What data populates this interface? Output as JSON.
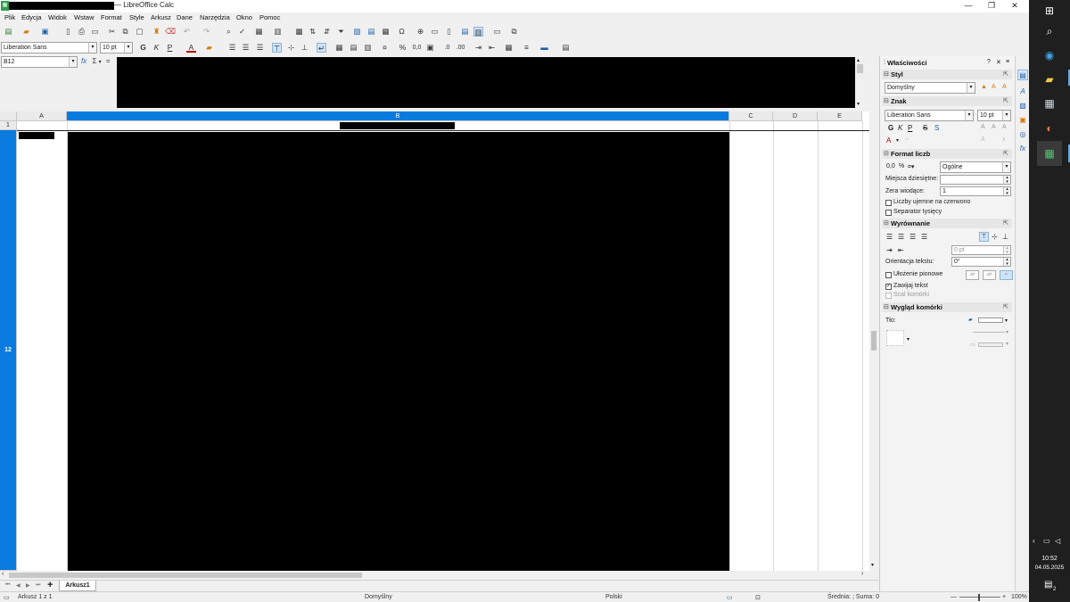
{
  "window": {
    "title": "— LibreOffice Calc",
    "controls": {
      "minimize": "—",
      "restore": "❐",
      "close": "✕"
    }
  },
  "menu": [
    "Plik",
    "Edycja",
    "Widok",
    "Wstaw",
    "Format",
    "Style",
    "Arkusz",
    "Dane",
    "Narzędzia",
    "Okno",
    "Pomoc"
  ],
  "toolbar": {
    "font_name": "Liberation Sans",
    "font_size": "10 pt",
    "bold": "G",
    "italic": "K",
    "underline": "P",
    "font_color_glyph": "A",
    "percent": "%",
    "number": "0,0"
  },
  "formula_bar": {
    "name_box": "B12",
    "fx": "fx",
    "sigma": "Σ",
    "equals": "="
  },
  "grid": {
    "columns": [
      "A",
      "B",
      "C",
      "D",
      "E"
    ],
    "active_column": "B",
    "rows": [
      "1",
      "12"
    ],
    "active_row": "12"
  },
  "sheets": {
    "active": "Arkusz1",
    "add": "+"
  },
  "status": {
    "sheet_info": "Arkusz 1 z 1",
    "page_style": "Domyślny",
    "language": "Polski",
    "summary": "Średnia: ; Suma: 0",
    "zoom": "100%"
  },
  "sidebar": {
    "title": "Właściwości",
    "help": "?",
    "close": "✕",
    "menu": "≡",
    "sections": {
      "style": {
        "title": "Styl",
        "value": "Domyślny"
      },
      "font": {
        "title": "Znak",
        "font_name": "Liberation Sans",
        "font_size": "10 pt",
        "bold": "G",
        "italic": "K",
        "underline": "P",
        "strike": "S",
        "shadow": "S"
      },
      "number_format": {
        "title": "Format liczb",
        "category": "Ogólne",
        "decimals_label": "Miejsca dziesiętne:",
        "decimals_value": "",
        "leading_zeros_label": "Zera wiodące:",
        "leading_zeros_value": "1",
        "negative_red_label": "Liczby ujemne na czerwono",
        "thousands_label": "Separator tysięcy"
      },
      "alignment": {
        "title": "Wyrównanie",
        "indent_value": "0 pt",
        "orientation_label": "Orientacja tekstu:",
        "orientation_value": "0°",
        "vertical_stack_label": "Ułożenie pionowe",
        "wrap_label": "Zawijaj tekst",
        "merge_label": "Scal komórki"
      },
      "cell_appearance": {
        "title": "Wygląd komórki",
        "background_label": "Tło:"
      }
    }
  },
  "taskbar": {
    "time": "10:52",
    "date": "04.05.2025",
    "notif_count": "2"
  }
}
